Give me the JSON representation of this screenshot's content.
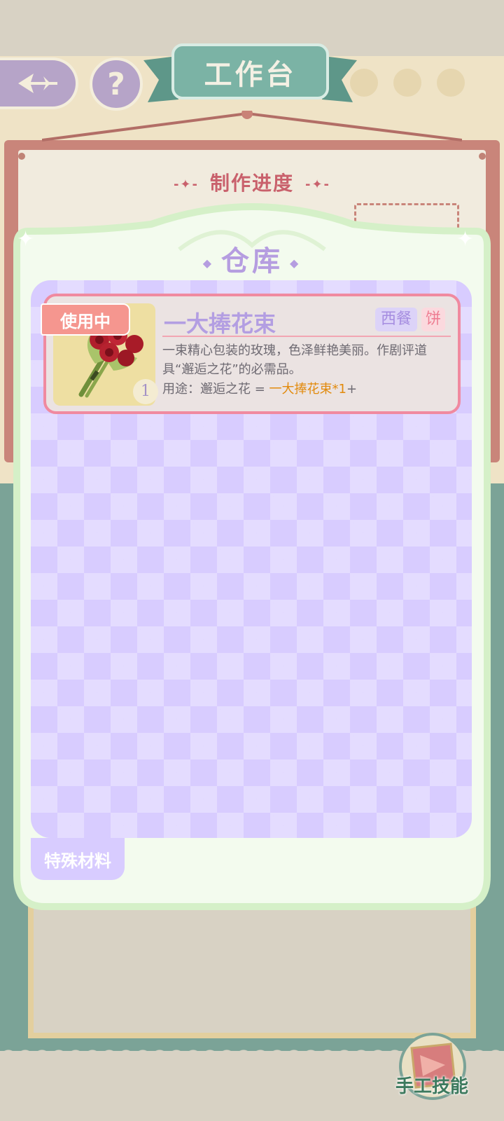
{
  "header": {
    "title": "工作台",
    "back_icon": "back-arrow-icon",
    "help_symbol": "?"
  },
  "progress": {
    "title": "制作进度",
    "deco_left": "-✦-",
    "deco_right": "-✦-"
  },
  "warehouse": {
    "title": "仓库",
    "items": [
      {
        "name": "一大捧花束",
        "status": "使用中",
        "count": "1",
        "tags": [
          "西餐",
          "饼"
        ],
        "description": "一束精心包装的玫瑰，色泽鲜艳美丽。作剧评道具“邂逅之花”的必需品。",
        "usage_prefix": "用途：邂逅之花 = ",
        "usage_highlight": "一大捧花束*1",
        "usage_suffix": "+"
      }
    ],
    "tabs": [
      {
        "label": "特殊材料",
        "active": true
      }
    ]
  },
  "footer": {
    "skill_label": "手工技能"
  },
  "colors": {
    "accent_purple": "#b59de0",
    "card_border": "#f08aa0",
    "highlight_orange": "#e28a0c",
    "banner_teal": "#6fa79a",
    "progress_red": "#c9616c"
  }
}
